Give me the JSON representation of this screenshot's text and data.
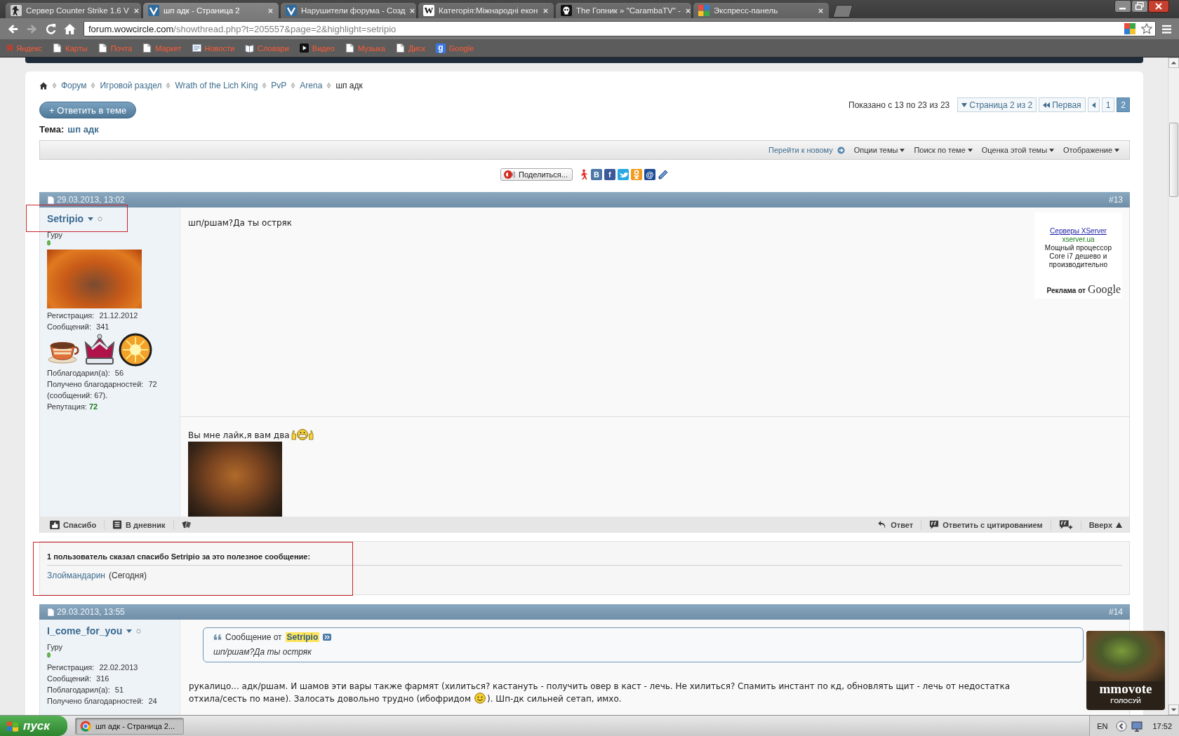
{
  "browser": {
    "tabs": [
      {
        "title": "Сервер Counter Strike 1.6 V",
        "kind": "figure",
        "selected": false
      },
      {
        "title": "шп адк - Страница 2",
        "kind": "chevron",
        "selected": true
      },
      {
        "title": "Нарушители форума - Созд",
        "kind": "chevron",
        "selected": false
      },
      {
        "title": "Категорія:Міжнародні екон",
        "kind": "letter",
        "glyph": "W",
        "selected": false
      },
      {
        "title": "The Гопник » \"CarambaTV\" -",
        "kind": "skull",
        "selected": false
      },
      {
        "title": "Экспресс-панель",
        "kind": "grid",
        "selected": false
      }
    ],
    "navigation": [
      {
        "kind": "back",
        "disabled": false
      },
      {
        "kind": "forward",
        "disabled": true
      },
      {
        "kind": "reload",
        "disabled": false
      },
      {
        "kind": "home",
        "disabled": false
      }
    ],
    "address": {
      "host": "forum.wowcircle.com",
      "path": "/showthread.php?t=205557&page=2&highlight=setripio"
    },
    "bookmarks": [
      {
        "label": "Яндекс",
        "kind": "letter",
        "glyph": "Я",
        "color": "#e8321e"
      },
      {
        "label": "Карты",
        "kind": "page"
      },
      {
        "label": "Почта",
        "kind": "page"
      },
      {
        "label": "Маркет",
        "kind": "page"
      },
      {
        "label": "Новости",
        "kind": "news"
      },
      {
        "label": "Словари",
        "kind": "book"
      },
      {
        "label": "Видео",
        "kind": "video"
      },
      {
        "label": "Музыка",
        "kind": "page"
      },
      {
        "label": "Диск",
        "kind": "page"
      },
      {
        "label": "Google",
        "kind": "tile",
        "glyph": "g",
        "color": "#3b78e7"
      }
    ]
  },
  "breadcrumb": [
    "Форум",
    "Игровой раздел",
    "Wrath of the Lich King",
    "PvP",
    "Arena",
    "шп адк"
  ],
  "reply_button": "+ Ответить в теме",
  "pagination": {
    "summary": "Показано с 13 по 23 из 23",
    "menu": "Страница 2 из 2",
    "first": "Первая",
    "pages": [
      {
        "label": "1",
        "selected": false
      },
      {
        "label": "2",
        "selected": true
      }
    ]
  },
  "thread": {
    "label": "Тема:",
    "title": "шп адк"
  },
  "thread_tools": [
    {
      "label": "Перейти к новому",
      "kind": "link"
    },
    {
      "label": "Опции темы",
      "kind": "menu"
    },
    {
      "label": "Поиск по теме",
      "kind": "menu"
    },
    {
      "label": "Оценка этой темы",
      "kind": "menu"
    },
    {
      "label": "Отображение",
      "kind": "menu"
    }
  ],
  "share": {
    "button": "Поделиться...",
    "services": [
      {
        "kind": "figure"
      },
      {
        "kind": "tile",
        "glyph": "В",
        "color": "#4a76a8"
      },
      {
        "kind": "tile",
        "glyph": "f",
        "color": "#3b5998"
      },
      {
        "kind": "bird"
      },
      {
        "kind": "person"
      },
      {
        "kind": "tile",
        "glyph": "@",
        "color": "#1f4e96"
      },
      {
        "kind": "pencil"
      }
    ]
  },
  "posts": [
    {
      "date": "29.03.2013, 13:02",
      "number": "#13",
      "author": {
        "name": "Setripio",
        "online": false,
        "highlighted": true,
        "title": "Гуру",
        "avatar": true,
        "stats": [
          {
            "label": "Регистрация:",
            "value": "21.12.2012"
          },
          {
            "label": "Сообщений:",
            "value": "341"
          }
        ],
        "awards": [
          {
            "kind": "cup"
          },
          {
            "kind": "crown"
          },
          {
            "kind": "sun"
          }
        ],
        "thanks_stats": [
          {
            "label": "Поблагодарил(а):",
            "value": "56"
          },
          {
            "label": "Получено благодарностей:",
            "value": "72 (сообщений: 67)."
          }
        ],
        "reputation": {
          "label": "Репутация:",
          "value": "72"
        }
      },
      "lines": [
        {
          "parts": [
            {
              "kind": "text",
              "text": "шп/ршам?Да ты остряк"
            }
          ]
        }
      ],
      "ad": {
        "link": "Серверы XServer",
        "domain": "xserver.ua",
        "text": "Мощный процессор Core i7 дешево и производительно",
        "label": "Реклама от",
        "brand": "Google"
      },
      "signature": {
        "content": [
          {
            "kind": "text",
            "text": "Вы мне лайк,я вам два"
          },
          {
            "kind": "thumbs_smiley"
          }
        ],
        "image": true
      },
      "actions_left": [
        {
          "kind": "thanks",
          "label": "Спасибо"
        },
        {
          "kind": "diary",
          "label": "В дневник"
        },
        {
          "kind": "report"
        }
      ],
      "actions_right": [
        {
          "kind": "reply",
          "label": "Ответ"
        },
        {
          "kind": "quote",
          "label": "Ответить с цитированием"
        },
        {
          "kind": "multiquote"
        },
        {
          "kind": "top",
          "label": "Вверх"
        }
      ],
      "thanks": {
        "highlighted": true,
        "summary": "1 пользователь сказал спасибо Setripio за это полезное сообщение:",
        "users": [
          {
            "name": "Злоймандарин",
            "when": "(Сегодня)"
          }
        ]
      }
    },
    {
      "date": "29.03.2013, 13:55",
      "number": "#14",
      "author": {
        "name": "I_come_for_you",
        "online": false,
        "highlighted": false,
        "title": "Гуру",
        "avatar": false,
        "stats": [
          {
            "label": "Регистрация:",
            "value": "22.02.2013"
          },
          {
            "label": "Сообщений:",
            "value": "316"
          }
        ],
        "thanks_stats": [
          {
            "label": "Поблагодарил(а):",
            "value": "51"
          },
          {
            "label": "Получено благодарностей:",
            "value": "24"
          }
        ]
      },
      "quote": {
        "label": "Сообщение от",
        "author": "Setripio",
        "search_hit": true,
        "text": "шп/ршам?Да ты остряк"
      },
      "lines": [
        {
          "parts": [
            {
              "kind": "text",
              "text": "рукалицо... адк/ршам. И шамов эти вары также фармят (хилиться? кастануть - получить овер в каст - лечь. Не хилиться? Спамить инстант по кд, обновлять щит - лечь от недостатка"
            }
          ]
        },
        {
          "parts": [
            {
              "kind": "text",
              "text": "отхила/сесть по мане). Залосать довольно трудно (ибофридом"
            },
            {
              "kind": "smiley"
            },
            {
              "kind": "text",
              "text": "). Шп-дк сильней сетап, имхо."
            }
          ]
        }
      ]
    }
  ],
  "vote_widget": {
    "title": "mmovote",
    "caption": "ГОЛОСУЙ"
  },
  "taskbar": {
    "start": "пуск",
    "tasks": [
      {
        "label": "шп адк - Страница 2...",
        "selected": true
      }
    ],
    "language": "EN",
    "clock": "17:52"
  }
}
